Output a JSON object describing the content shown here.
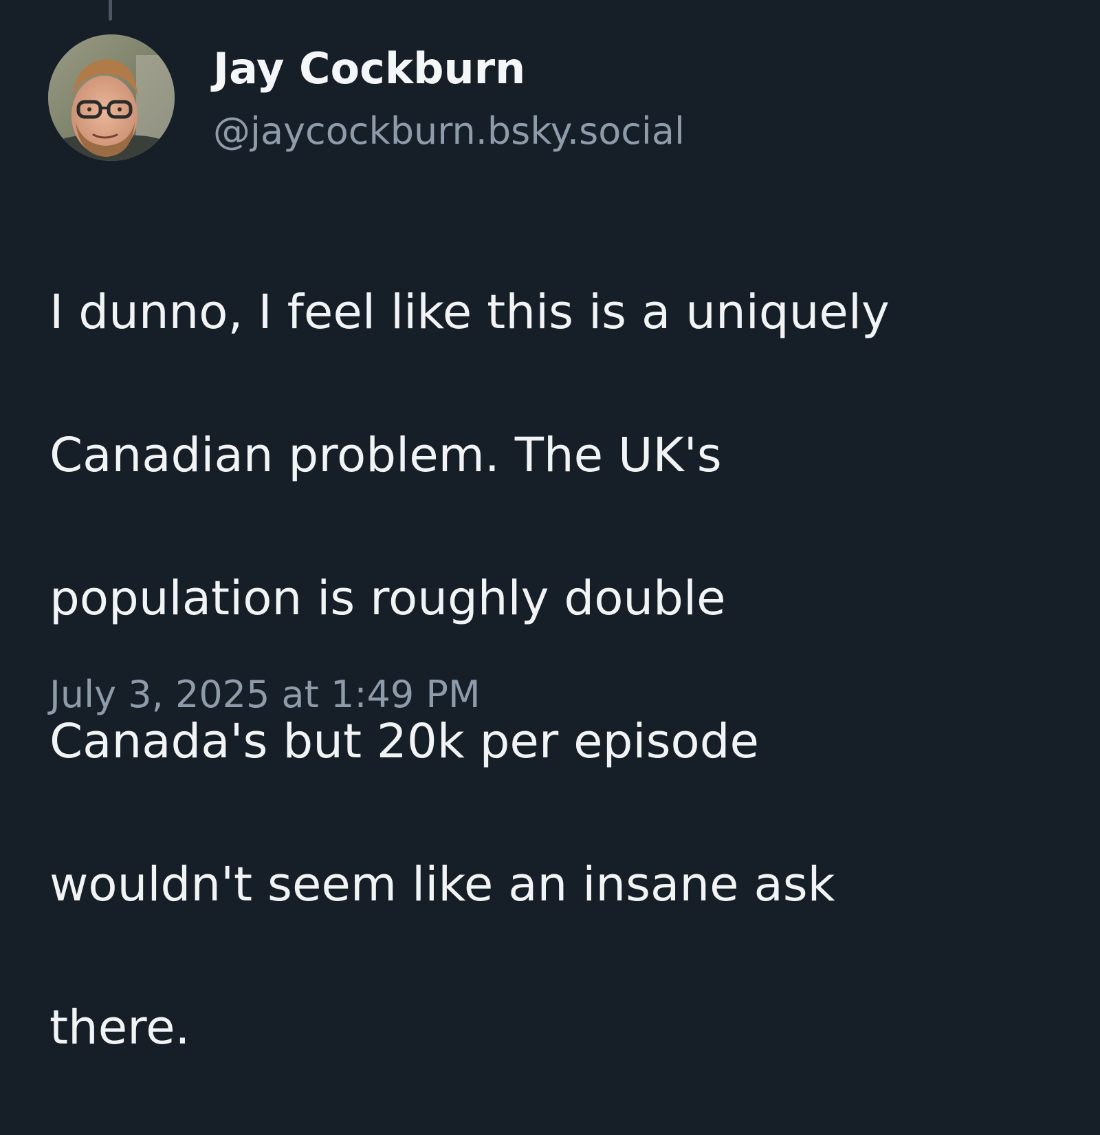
{
  "post": {
    "author": {
      "display_name": "Jay Cockburn",
      "handle": "@jaycockburn.bsky.social",
      "avatar_icon": "user-avatar-photo"
    },
    "lines": [
      "I dunno, I feel like this is a uniquely",
      "Canadian problem. The UK's",
      "population is roughly double",
      "Canada's but 20k per episode",
      "wouldn't seem like an insane ask",
      "there."
    ],
    "timestamp": "July 3, 2025 at 1:49 PM"
  },
  "colors": {
    "background": "#161e27",
    "primary_text": "#f1f3f5",
    "secondary_text": "#8e9baa",
    "thread_line": "#4b5563"
  }
}
